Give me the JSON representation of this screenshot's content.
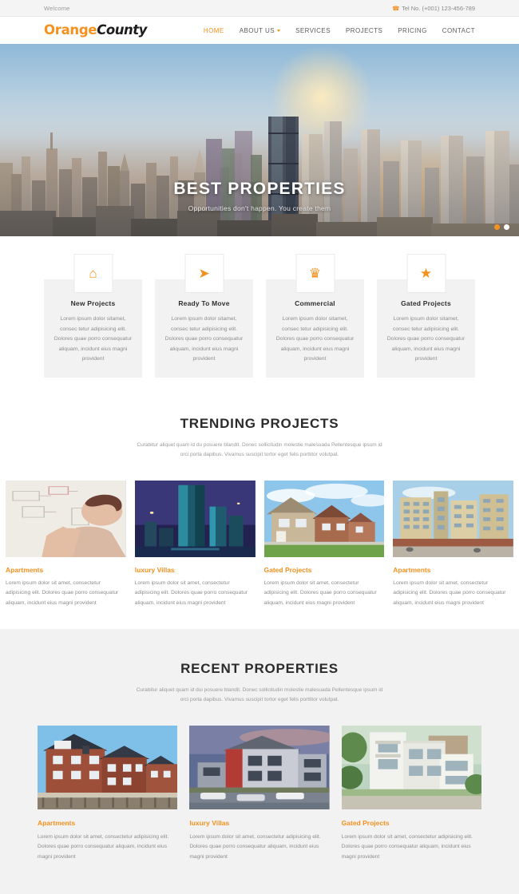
{
  "topbar": {
    "welcome": "Welcome",
    "phone_icon": "phone-icon",
    "tel": "Tel No. (+001) 123-456-789"
  },
  "header": {
    "logo_part1": "Orange",
    "logo_part2": "County",
    "nav": [
      {
        "label": "HOME",
        "active": true,
        "has_caret": false
      },
      {
        "label": "ABOUT US",
        "active": false,
        "has_caret": true
      },
      {
        "label": "SERVICES",
        "active": false,
        "has_caret": false
      },
      {
        "label": "PROJECTS",
        "active": false,
        "has_caret": false
      },
      {
        "label": "PRICING",
        "active": false,
        "has_caret": false
      },
      {
        "label": "CONTACT",
        "active": false,
        "has_caret": false
      }
    ]
  },
  "hero": {
    "title": "BEST PROPERTIES",
    "subtitle": "Opportunities don't happen. You create them",
    "slides": [
      {
        "active": true
      },
      {
        "active": false
      }
    ]
  },
  "features": [
    {
      "icon": "home-icon",
      "title": "New Projects",
      "text": "Lorem ipsum dolor sitamet, consec tetur adipisicing elit. Dolores quae porro consequatur aliquam, incidunt eius magni provident"
    },
    {
      "icon": "rocket-icon",
      "title": "Ready To Move",
      "text": "Lorem ipsum dolor sitamet, consec tetur adipisicing elit. Dolores quae porro consequatur aliquam, incidunt eius magni provident"
    },
    {
      "icon": "trophy-icon",
      "title": "Commercial",
      "text": "Lorem ipsum dolor sitamet, consec tetur adipisicing elit. Dolores quae porro consequatur aliquam, incidunt eius magni provident"
    },
    {
      "icon": "star-icon",
      "title": "Gated Projects",
      "text": "Lorem ipsum dolor sitamet, consec tetur adipisicing elit. Dolores quae porro consequatur aliquam, incidunt eius magni provident"
    }
  ],
  "trending": {
    "title": "TRENDING PROJECTS",
    "subtitle": "Curabitur aliquet quam id du posuere blandit. Donec sollicitudin molestie malesuada Pellentesque ipsum id orci porta dapibus. Vivamus suscipit tortor eget felis porttitor volutpat.",
    "cards": [
      {
        "image": "architect-drawing-photo",
        "title": "Apartments",
        "text": "Lorem ipsum dolor sit amet, consectetur adipisicing elit. Dolores quae porro consequatur aliquam, incidunt eius magni provident"
      },
      {
        "image": "glass-tower-night-photo",
        "title": "luxury Villas",
        "text": "Lorem ipsum dolor sit amet, consectetur adipisicing elit. Dolores quae porro consequatur aliquam, incidunt eius magni provident"
      },
      {
        "image": "townhouse-row-photo",
        "title": "Gated Projects",
        "text": "Lorem ipsum dolor sit amet, consectetur adipisicing elit. Dolores quae porro consequatur aliquam, incidunt eius magni provident"
      },
      {
        "image": "apartment-block-photo",
        "title": "Apartments",
        "text": "Lorem ipsum dolor sit amet, consectetur adipisicing elit. Dolores quae porro consequatur aliquam, incidunt eius magni provident"
      }
    ]
  },
  "recent": {
    "title": "RECENT PROPERTIES",
    "subtitle": "Curabitur aliquet quam id dui posuere blandit. Donec sollicitudin molestie malesuada Pellentesque ipsum id orci porta dapibus. Vivamus suscipit tortor eget felis porttitor volutpat.",
    "cards": [
      {
        "image": "brick-houses-photo",
        "title": "Apartments",
        "text": "Lorem ipsum dolor sit amet, consectetur adipisicing elit. Dolores quae porro consequatur aliquam, incidunt eius magni provident"
      },
      {
        "image": "modern-duplex-photo",
        "title": "luxury Villas",
        "text": "Lorem ipsum dolor sit amet, consectetur adipisicing elit. Dolores quae porro consequatur aliquam, incidunt eius magni provident"
      },
      {
        "image": "white-villa-photo",
        "title": "Gated Projects",
        "text": "Lorem ipsum dolor sit amet, consectetur adipisicing elit. Dolores quae porro consequatur aliquam, incidunt eius magni provident"
      }
    ]
  },
  "colors": {
    "accent": "#f5911e",
    "topbar_bg": "#f4f4f4",
    "feature_bg": "#f2f2f2",
    "recent_bg": "#f2f2f2",
    "text_dark": "#2b2b2b",
    "text_muted": "#8d8d8d"
  }
}
